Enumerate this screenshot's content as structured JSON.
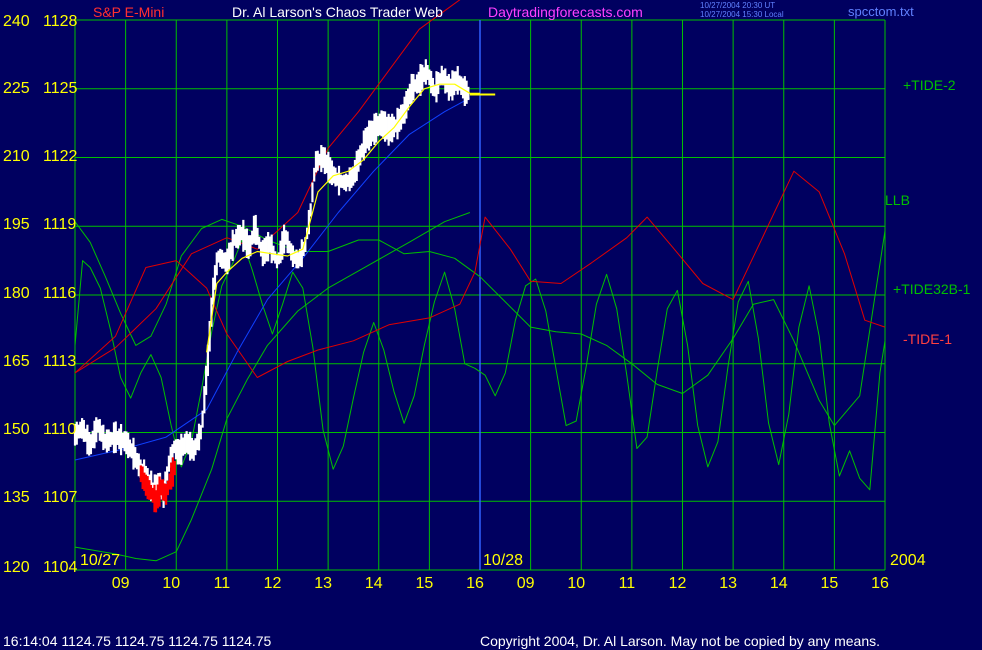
{
  "header": {
    "instrument": "S&P E-Mini",
    "title": "Dr. Al Larson's Chaos Trader Web",
    "website": "Daytradingforecasts.com",
    "timestamp_ut": "10/27/2004 20:30 UT",
    "timestamp_local": "10/27/2004 15:30 Local",
    "filename": "spcctom.txt"
  },
  "footer": {
    "quote": "16:14:04   1124.75 1124.75 1124.75 1124.75",
    "copyright": "Copyright 2004, Dr. Al Larson. May not be copied by any means."
  },
  "colors": {
    "background": "#000060",
    "grid": "#00c000",
    "axis_text": "#ffff00",
    "price_bars": "#ffffff",
    "red_bars": "#ff0000",
    "green_series": "#00c000",
    "red_series": "#e00000",
    "blue_series": "#1040ff",
    "yellow_series": "#ffff00",
    "title_white": "#ffffff",
    "website_magenta": "#ff40ff",
    "instrument_red": "#ff3030",
    "filename_blue": "#6080ff"
  },
  "chart_data": {
    "type": "line",
    "left_axis_ticks": [
      "240",
      "225",
      "210",
      "195",
      "180",
      "165",
      "150",
      "135",
      "120"
    ],
    "right_price_ticks": [
      "1128",
      "1125",
      "1122",
      "1119",
      "1116",
      "1113",
      "1110",
      "1107",
      "1104"
    ],
    "y_range": [
      1104,
      1128
    ],
    "hours": [
      "09",
      "10",
      "11",
      "12",
      "13",
      "14",
      "15",
      "16",
      "09",
      "10",
      "11",
      "12",
      "13",
      "14",
      "15",
      "16"
    ],
    "date_labels": [
      "10/27",
      "10/28",
      "2004"
    ],
    "series_labels": [
      "+TIDE-2",
      "LLB",
      "+TIDE32B-1",
      "-TIDE-1"
    ],
    "last_price": 1124.75,
    "price_path": [
      [
        0.0,
        1109.9
      ],
      [
        0.15,
        1110.2
      ],
      [
        0.3,
        1109.4
      ],
      [
        0.45,
        1110.3
      ],
      [
        0.6,
        1109.6
      ],
      [
        0.8,
        1109.8
      ],
      [
        1.0,
        1109.6
      ],
      [
        1.15,
        1109.1
      ],
      [
        1.3,
        1108.4
      ],
      [
        1.45,
        1108.0
      ],
      [
        1.55,
        1107.4
      ],
      [
        1.65,
        1107.9
      ],
      [
        1.75,
        1107.3
      ],
      [
        1.85,
        1108.6
      ],
      [
        1.95,
        1109.4
      ],
      [
        2.05,
        1109.1
      ],
      [
        2.2,
        1109.6
      ],
      [
        2.35,
        1109.2
      ],
      [
        2.5,
        1110.1
      ],
      [
        2.62,
        1113.0
      ],
      [
        2.72,
        1116.0
      ],
      [
        2.82,
        1117.7
      ],
      [
        3.0,
        1117.4
      ],
      [
        3.15,
        1118.4
      ],
      [
        3.3,
        1118.7
      ],
      [
        3.45,
        1118.0
      ],
      [
        3.55,
        1119.0
      ],
      [
        3.7,
        1117.8
      ],
      [
        3.85,
        1118.2
      ],
      [
        4.0,
        1117.4
      ],
      [
        4.15,
        1118.6
      ],
      [
        4.3,
        1117.7
      ],
      [
        4.42,
        1117.5
      ],
      [
        4.55,
        1118.2
      ],
      [
        4.65,
        1119.6
      ],
      [
        4.75,
        1121.8
      ],
      [
        4.9,
        1122.0
      ],
      [
        5.05,
        1121.4
      ],
      [
        5.2,
        1121.0
      ],
      [
        5.35,
        1120.9
      ],
      [
        5.5,
        1121.2
      ],
      [
        5.62,
        1122.0
      ],
      [
        5.75,
        1122.8
      ],
      [
        5.9,
        1123.2
      ],
      [
        6.05,
        1123.5
      ],
      [
        6.2,
        1123.2
      ],
      [
        6.35,
        1123.4
      ],
      [
        6.5,
        1124.0
      ],
      [
        6.65,
        1125.0
      ],
      [
        6.8,
        1125.3
      ],
      [
        6.95,
        1125.8
      ],
      [
        7.1,
        1124.9
      ],
      [
        7.25,
        1125.6
      ],
      [
        7.4,
        1125.0
      ],
      [
        7.55,
        1125.4
      ],
      [
        7.7,
        1124.9
      ],
      [
        7.8,
        1124.75
      ]
    ],
    "red_lows": [
      [
        1.3,
        1108.2
      ],
      [
        1.4,
        1107.7
      ],
      [
        1.5,
        1107.4
      ],
      [
        1.6,
        1107.0
      ],
      [
        1.7,
        1107.6
      ],
      [
        1.8,
        1107.3
      ],
      [
        1.9,
        1108.1
      ],
      [
        2.0,
        1108.6
      ]
    ],
    "yellow_ma": [
      [
        2.6,
        1113.5
      ],
      [
        2.8,
        1116.5
      ],
      [
        3.0,
        1117.0
      ],
      [
        3.3,
        1117.6
      ],
      [
        3.6,
        1117.9
      ],
      [
        3.9,
        1117.8
      ],
      [
        4.2,
        1117.7
      ],
      [
        4.5,
        1118.0
      ],
      [
        4.8,
        1120.5
      ],
      [
        5.1,
        1121.2
      ],
      [
        5.4,
        1121.4
      ],
      [
        5.7,
        1121.9
      ],
      [
        6.0,
        1122.7
      ],
      [
        6.3,
        1123.3
      ],
      [
        6.6,
        1124.2
      ],
      [
        6.9,
        1125.0
      ],
      [
        7.2,
        1125.2
      ],
      [
        7.5,
        1125.2
      ],
      [
        7.8,
        1124.8
      ],
      [
        8.0,
        1124.8
      ]
    ],
    "blue_line": [
      [
        0.0,
        1108.8
      ],
      [
        1.0,
        1109.3
      ],
      [
        1.8,
        1109.8
      ],
      [
        2.6,
        1111.0
      ],
      [
        3.2,
        1113.5
      ],
      [
        3.8,
        1115.8
      ],
      [
        4.5,
        1117.6
      ],
      [
        5.2,
        1119.6
      ],
      [
        5.9,
        1121.4
      ],
      [
        6.6,
        1123.0
      ],
      [
        7.3,
        1124.0
      ],
      [
        7.8,
        1124.6
      ]
    ],
    "red_upper": [
      [
        0.0,
        1112.6
      ],
      [
        0.8,
        1113.7
      ],
      [
        1.6,
        1115.4
      ],
      [
        2.3,
        1117.8
      ],
      [
        3.0,
        1118.5
      ],
      [
        3.6,
        1118.0
      ],
      [
        4.4,
        1119.6
      ],
      [
        5.0,
        1122.4
      ],
      [
        5.6,
        1124.0
      ],
      [
        6.2,
        1125.8
      ],
      [
        6.8,
        1127.6
      ],
      [
        7.3,
        1128.4
      ],
      [
        7.8,
        1129.2
      ]
    ],
    "red_tide": [
      [
        0.0,
        1112.6
      ],
      [
        0.8,
        1114.2
      ],
      [
        1.4,
        1117.2
      ],
      [
        2.0,
        1117.5
      ],
      [
        2.6,
        1116.3
      ],
      [
        3.0,
        1114.3
      ],
      [
        3.6,
        1112.4
      ],
      [
        4.2,
        1113.1
      ],
      [
        4.8,
        1113.6
      ],
      [
        5.5,
        1114.0
      ],
      [
        6.2,
        1114.7
      ],
      [
        7.0,
        1115.0
      ],
      [
        7.6,
        1115.6
      ],
      [
        7.9,
        1117.0
      ],
      [
        8.1,
        1119.4
      ],
      [
        8.6,
        1118.0
      ],
      [
        9.0,
        1116.6
      ],
      [
        9.6,
        1116.5
      ],
      [
        10.2,
        1117.4
      ],
      [
        10.9,
        1118.5
      ],
      [
        11.3,
        1119.4
      ],
      [
        11.8,
        1118.1
      ],
      [
        12.4,
        1116.5
      ],
      [
        13.0,
        1115.8
      ],
      [
        13.6,
        1118.6
      ],
      [
        14.2,
        1121.4
      ],
      [
        14.7,
        1120.5
      ],
      [
        15.2,
        1117.8
      ],
      [
        15.6,
        1114.9
      ],
      [
        16.0,
        1114.6
      ]
    ],
    "green_llb": [
      [
        0.0,
        1105.0
      ],
      [
        0.8,
        1104.7
      ],
      [
        1.2,
        1104.5
      ],
      [
        1.6,
        1104.4
      ],
      [
        2.0,
        1104.8
      ],
      [
        2.3,
        1106.2
      ],
      [
        2.7,
        1108.4
      ],
      [
        3.0,
        1110.6
      ],
      [
        3.4,
        1112.3
      ],
      [
        3.8,
        1113.8
      ],
      [
        4.4,
        1115.3
      ],
      [
        5.0,
        1116.3
      ],
      [
        5.8,
        1117.3
      ],
      [
        6.6,
        1118.3
      ],
      [
        7.3,
        1119.2
      ],
      [
        7.8,
        1119.6
      ]
    ],
    "green_tide32": [
      [
        0.0,
        1119.2
      ],
      [
        0.3,
        1118.3
      ],
      [
        0.6,
        1116.8
      ],
      [
        0.9,
        1115.2
      ],
      [
        1.2,
        1113.8
      ],
      [
        1.5,
        1114.2
      ],
      [
        1.8,
        1115.6
      ],
      [
        2.1,
        1117.7
      ],
      [
        2.5,
        1118.9
      ],
      [
        2.9,
        1119.3
      ],
      [
        3.3,
        1119.0
      ],
      [
        3.8,
        1118.4
      ],
      [
        4.4,
        1117.9
      ],
      [
        5.0,
        1117.9
      ],
      [
        5.6,
        1118.4
      ],
      [
        6.0,
        1118.4
      ],
      [
        6.5,
        1117.8
      ],
      [
        7.0,
        1117.9
      ],
      [
        7.5,
        1117.6
      ],
      [
        8.0,
        1116.8
      ],
      [
        8.5,
        1115.7
      ],
      [
        9.0,
        1114.6
      ],
      [
        9.5,
        1114.4
      ],
      [
        10.0,
        1114.3
      ],
      [
        10.5,
        1113.8
      ],
      [
        11.0,
        1113.0
      ],
      [
        11.5,
        1112.1
      ],
      [
        12.0,
        1111.7
      ],
      [
        12.5,
        1112.5
      ],
      [
        13.0,
        1114.1
      ],
      [
        13.4,
        1115.6
      ],
      [
        13.8,
        1115.8
      ],
      [
        14.2,
        1114.0
      ],
      [
        14.7,
        1111.4
      ],
      [
        15.0,
        1110.3
      ],
      [
        15.5,
        1111.6
      ],
      [
        16.0,
        1118.8
      ]
    ],
    "green_tide": [
      [
        0.0,
        1113.8
      ],
      [
        0.15,
        1117.5
      ],
      [
        0.3,
        1117.2
      ],
      [
        0.5,
        1116.3
      ],
      [
        0.7,
        1114.5
      ],
      [
        0.9,
        1112.4
      ],
      [
        1.1,
        1111.5
      ],
      [
        1.3,
        1112.6
      ],
      [
        1.5,
        1113.4
      ],
      [
        1.7,
        1112.4
      ],
      [
        1.9,
        1110.3
      ],
      [
        2.1,
        1108.5
      ],
      [
        2.3,
        1109.6
      ],
      [
        2.5,
        1111.9
      ],
      [
        2.7,
        1114.4
      ],
      [
        2.9,
        1116.4
      ],
      [
        3.1,
        1117.3
      ],
      [
        3.3,
        1118.4
      ],
      [
        3.5,
        1117.1
      ],
      [
        3.7,
        1115.6
      ],
      [
        3.9,
        1114.3
      ],
      [
        4.1,
        1115.6
      ],
      [
        4.3,
        1117.0
      ],
      [
        4.5,
        1116.3
      ],
      [
        4.7,
        1113.7
      ],
      [
        4.9,
        1110.1
      ],
      [
        5.1,
        1108.4
      ],
      [
        5.3,
        1109.4
      ],
      [
        5.5,
        1111.5
      ],
      [
        5.7,
        1113.5
      ],
      [
        5.9,
        1114.8
      ],
      [
        6.1,
        1113.6
      ],
      [
        6.3,
        1111.8
      ],
      [
        6.5,
        1110.4
      ],
      [
        6.7,
        1111.6
      ],
      [
        6.9,
        1113.8
      ],
      [
        7.1,
        1115.7
      ],
      [
        7.3,
        1117.0
      ],
      [
        7.5,
        1115.4
      ],
      [
        7.7,
        1113.0
      ],
      [
        7.9,
        1112.8
      ],
      [
        8.1,
        1112.5
      ],
      [
        8.3,
        1111.6
      ],
      [
        8.5,
        1112.6
      ],
      [
        8.7,
        1114.9
      ],
      [
        8.9,
        1116.4
      ],
      [
        9.1,
        1116.7
      ],
      [
        9.3,
        1115.3
      ],
      [
        9.5,
        1112.8
      ],
      [
        9.7,
        1110.3
      ],
      [
        9.9,
        1110.5
      ],
      [
        10.1,
        1112.9
      ],
      [
        10.3,
        1115.6
      ],
      [
        10.5,
        1116.9
      ],
      [
        10.7,
        1115.4
      ],
      [
        10.9,
        1112.5
      ],
      [
        11.1,
        1109.3
      ],
      [
        11.3,
        1109.8
      ],
      [
        11.5,
        1112.7
      ],
      [
        11.7,
        1115.4
      ],
      [
        11.9,
        1116.2
      ],
      [
        12.1,
        1113.8
      ],
      [
        12.3,
        1110.3
      ],
      [
        12.5,
        1108.5
      ],
      [
        12.7,
        1109.6
      ],
      [
        12.9,
        1112.9
      ],
      [
        13.1,
        1115.7
      ],
      [
        13.3,
        1116.6
      ],
      [
        13.5,
        1114.1
      ],
      [
        13.7,
        1110.4
      ],
      [
        13.9,
        1108.6
      ],
      [
        14.1,
        1110.8
      ],
      [
        14.3,
        1114.6
      ],
      [
        14.5,
        1116.4
      ],
      [
        14.7,
        1114.2
      ],
      [
        14.9,
        1110.4
      ],
      [
        15.1,
        1108.1
      ],
      [
        15.3,
        1109.2
      ],
      [
        15.5,
        1108.0
      ],
      [
        15.7,
        1107.5
      ],
      [
        15.9,
        1112.6
      ],
      [
        16.0,
        1114.0
      ]
    ]
  }
}
